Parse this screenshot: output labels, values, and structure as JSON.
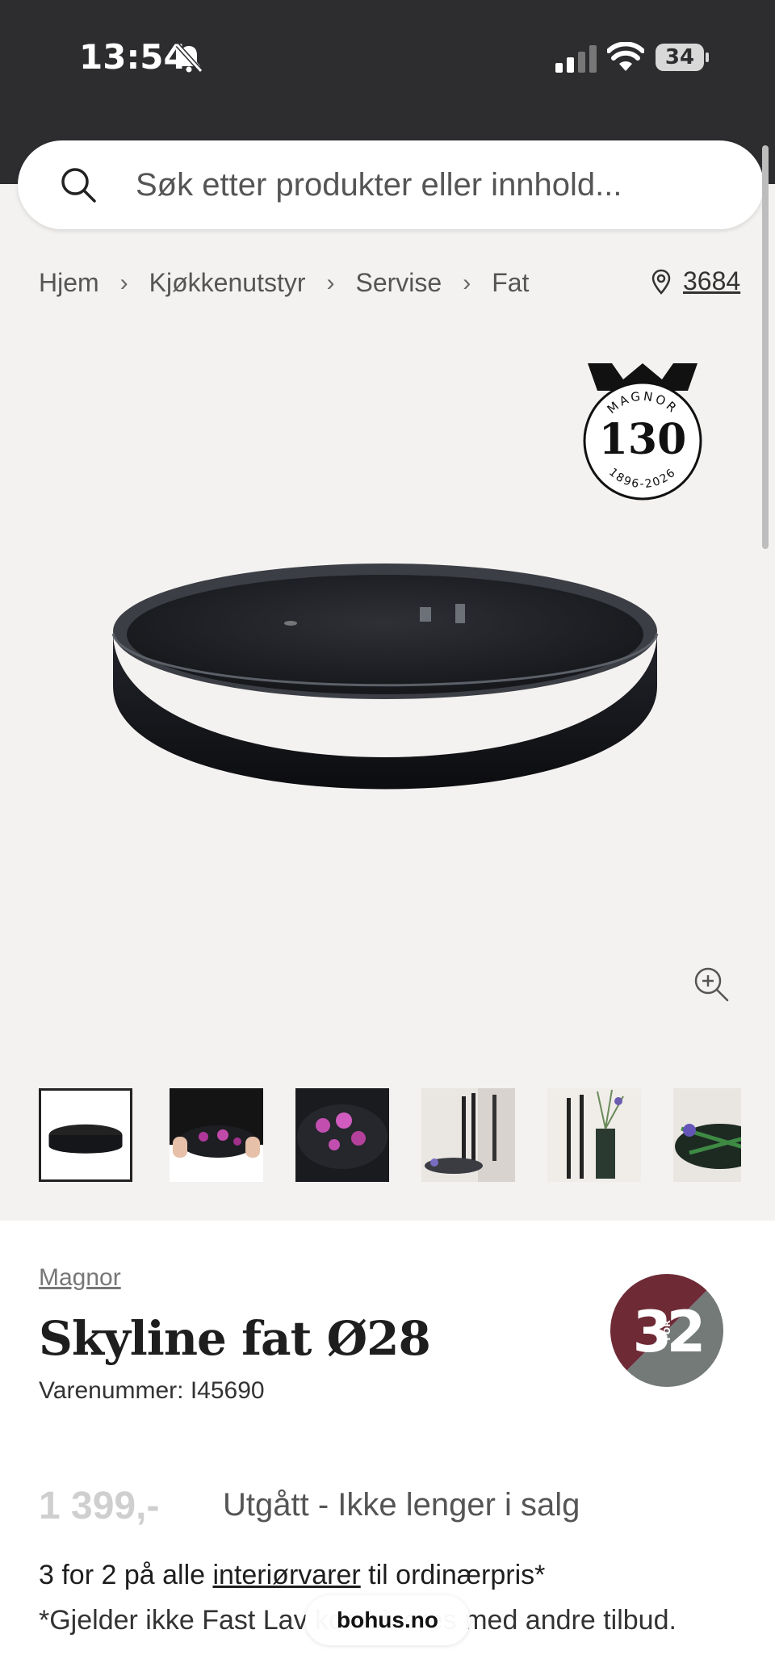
{
  "status_bar": {
    "time": "13:54",
    "battery": "34"
  },
  "search": {
    "placeholder": "Søk etter produkter eller innhold..."
  },
  "breadcrumb": [
    "Hjem",
    "Kjøkkenutstyr",
    "Servise",
    "Fat"
  ],
  "store": {
    "number": "3684"
  },
  "logo130": {
    "brand": "MAGNOR",
    "number": "130",
    "years": "1896-2026"
  },
  "product": {
    "brand": "Magnor",
    "title": "Skyline fat Ø28",
    "sku": "Varenummer: I45690",
    "price": "1 399,-",
    "status": "Utgått - Ikke lenger i salg",
    "badge": {
      "left": "3",
      "middle": "FOR",
      "right": "2"
    }
  },
  "offer": {
    "pre": "3 for 2 på alle ",
    "link": "interiørvarer",
    "post": " til ordinærpris*",
    "terms": "*Gjelder ikke Fast Lav                         kombineres med andre tilbud."
  },
  "browser": {
    "url": "bohus.no"
  }
}
